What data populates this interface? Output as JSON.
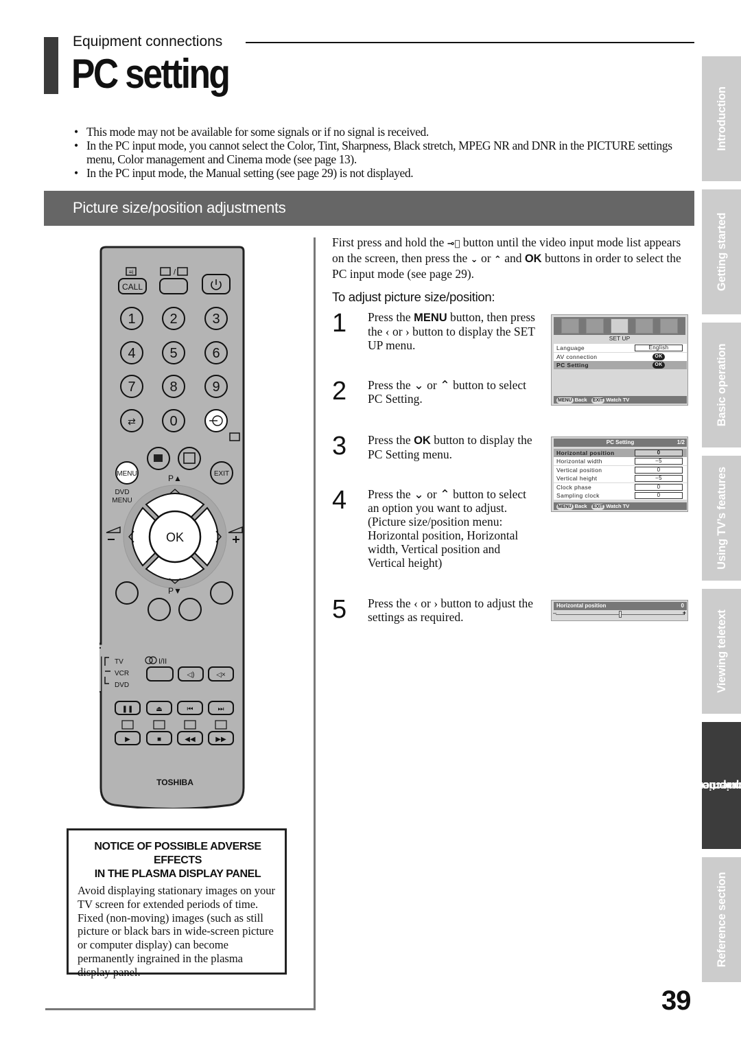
{
  "header": {
    "section": "Equipment connections",
    "title": "PC setting"
  },
  "notes": [
    "This mode may not be available for some signals or if no signal is received.",
    "In the PC input mode, you cannot select the Color, Tint, Sharpness, Black stretch, MPEG NR and DNR in the PICTURE settings menu, Color management and Cinema mode (see page 13).",
    "In the PC input mode, the Manual setting (see page 29) is not displayed."
  ],
  "banner": "Picture size/position adjustments",
  "intro": {
    "part1": "First press and hold the ",
    "input_icon": "input-select-icon",
    "part2": " button until the video input mode list appears on the screen, then press the ",
    "down": "⌄",
    "or": " or ",
    "up": "⌃",
    "and": " and ",
    "ok": "OK",
    "part3": " buttons in order to select the PC input mode (see page 29)."
  },
  "subhead": "To adjust picture size/position:",
  "steps": [
    {
      "num": "1",
      "a": "Press the ",
      "b": "MENU",
      "c": " button, then press the ‹ or › button to display the SET UP menu."
    },
    {
      "num": "2",
      "a": "Press the ⌄ or ⌃ button to select PC Setting.",
      "b": "",
      "c": ""
    },
    {
      "num": "3",
      "a": "Press the ",
      "b": "OK",
      "c": " button to display the PC Setting menu."
    },
    {
      "num": "4",
      "a": "Press the ⌄ or ⌃ button to select an option you want to adjust. (Picture size/position menu: Horizontal position, Horizontal width, Vertical position and Vertical height)",
      "b": "",
      "c": ""
    },
    {
      "num": "5",
      "a": "Press the ‹ or › button to adjust the settings as required.",
      "b": "",
      "c": ""
    }
  ],
  "osd_setup": {
    "title": "SET UP",
    "icons": [
      "picture-icon",
      "sound-icon",
      "setup-icon",
      "timer-icon",
      "tools-icon"
    ],
    "rows": [
      {
        "label": "Language",
        "value": "English"
      },
      {
        "label": "AV connection",
        "value": "OK"
      },
      {
        "label": "PC Setting",
        "value": "OK"
      }
    ],
    "footer_menu": "MENU",
    "footer_back": "Back",
    "footer_exit": "EXIT",
    "footer_watch": "Watch TV"
  },
  "osd_pc": {
    "title": "PC Setting",
    "page": "1/2",
    "rows": [
      {
        "label": "Horizontal position",
        "value": "0"
      },
      {
        "label": "Horizontal width",
        "value": "−5"
      },
      {
        "label": "Vertical position",
        "value": "0"
      },
      {
        "label": "Vertical height",
        "value": "−5"
      },
      {
        "label": "Clock phase",
        "value": "0"
      },
      {
        "label": "Sampling clock",
        "value": "0"
      }
    ],
    "footer_menu": "MENU",
    "footer_back": "Back",
    "footer_exit": "EXIT",
    "footer_watch": "Watch TV"
  },
  "osd_slider": {
    "label": "Horizontal position",
    "value": "0",
    "minus": "–",
    "plus": "+",
    "position_fraction": 0.5
  },
  "remote": {
    "call": "CALL",
    "digits": [
      "1",
      "2",
      "3",
      "4",
      "5",
      "6",
      "7",
      "8",
      "9",
      "0"
    ],
    "menu": "MENU",
    "exit": "EXIT",
    "dvd_menu_1": "DVD",
    "dvd_menu_2": "MENU",
    "p_up": "P▲",
    "p_down": "P▼",
    "ok": "OK",
    "tv": "TV",
    "vcr": "VCR",
    "dvd": "DVD",
    "dual": "I/II",
    "brand": "TOSHIBA"
  },
  "notice": {
    "heading_1": "NOTICE OF POSSIBLE ADVERSE EFFECTS",
    "heading_2": "IN THE PLASMA DISPLAY PANEL",
    "body": "Avoid displaying stationary images on your TV screen for extended periods of time. Fixed (non-moving) images (such as still picture or black bars in wide-screen picture or computer display) can become permanently ingrained in the plasma display panel."
  },
  "side_tabs": [
    {
      "label": "Introduction",
      "active": false
    },
    {
      "label": "Getting started",
      "active": false
    },
    {
      "label": "Basic operation",
      "active": false
    },
    {
      "label": "Using TV’s features",
      "active": false
    },
    {
      "label": "Viewing teletext",
      "active": false
    },
    {
      "label_1": "Equipment",
      "label_2": "connections",
      "active": true
    },
    {
      "label": "Reference section",
      "active": false
    }
  ],
  "page_number": "39",
  "colors": {
    "banner": "#666666",
    "tab_inactive": "#cccccc",
    "tab_active": "#3c3c3c",
    "remote_body": "#b4b4b4"
  }
}
